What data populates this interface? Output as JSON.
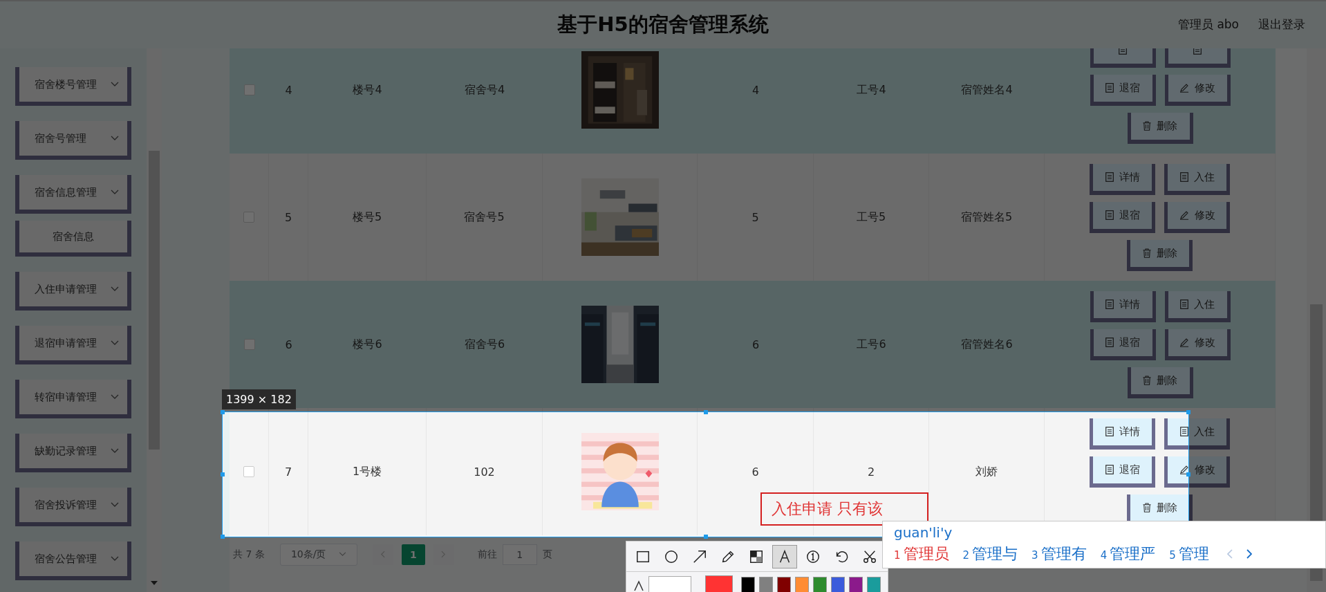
{
  "header": {
    "title": "基于H5的宿舍管理系统",
    "user": "管理员 abo",
    "logout": "退出登录"
  },
  "sidebar": {
    "items": [
      {
        "label": "宿舍楼号管理",
        "kind": "group"
      },
      {
        "label": "宿舍号管理",
        "kind": "group"
      },
      {
        "label": "宿舍信息管理",
        "kind": "group"
      },
      {
        "label": "宿舍信息",
        "kind": "item"
      },
      {
        "label": "入住申请管理",
        "kind": "group"
      },
      {
        "label": "退宿申请管理",
        "kind": "group"
      },
      {
        "label": "转宿申请管理",
        "kind": "group"
      },
      {
        "label": "缺勤记录管理",
        "kind": "group"
      },
      {
        "label": "宿舍投诉管理",
        "kind": "group"
      },
      {
        "label": "宿舍公告管理",
        "kind": "group"
      }
    ]
  },
  "table": {
    "rows": [
      {
        "checked": false,
        "id": "4",
        "building": "楼号4",
        "room": "宿舍号4",
        "count": "4",
        "staff_no": "工号4",
        "staff_name": "宿管姓名4",
        "actions": [
          {
            "kind": "doc"
          },
          {
            "kind": "doc"
          },
          {
            "label": "退宿",
            "kind": "doc"
          },
          {
            "label": "修改",
            "kind": "edit"
          },
          {
            "label": "删除",
            "kind": "delete"
          }
        ]
      },
      {
        "checked": false,
        "id": "5",
        "building": "楼号5",
        "room": "宿舍号5",
        "count": "5",
        "staff_no": "工号5",
        "staff_name": "宿管姓名5",
        "actions": [
          {
            "label": "详情",
            "kind": "doc"
          },
          {
            "label": "入住",
            "kind": "doc"
          },
          {
            "label": "退宿",
            "kind": "doc"
          },
          {
            "label": "修改",
            "kind": "edit"
          },
          {
            "label": "删除",
            "kind": "delete"
          }
        ]
      },
      {
        "checked": false,
        "id": "6",
        "building": "楼号6",
        "room": "宿舍号6",
        "count": "6",
        "staff_no": "工号6",
        "staff_name": "宿管姓名6",
        "actions": [
          {
            "label": "详情",
            "kind": "doc"
          },
          {
            "label": "入住",
            "kind": "doc"
          },
          {
            "label": "退宿",
            "kind": "doc"
          },
          {
            "label": "修改",
            "kind": "edit"
          },
          {
            "label": "删除",
            "kind": "delete"
          }
        ]
      },
      {
        "checked": false,
        "id": "7",
        "building": "1号楼",
        "room": "102",
        "count": "6",
        "staff_no": "2",
        "staff_name": "刘娇",
        "actions": [
          {
            "label": "详情",
            "kind": "doc"
          },
          {
            "label": "入住",
            "kind": "doc"
          },
          {
            "label": "退宿",
            "kind": "doc"
          },
          {
            "label": "修改",
            "kind": "edit"
          },
          {
            "label": "删除",
            "kind": "delete"
          }
        ]
      }
    ]
  },
  "pagination": {
    "total": "共 7 条",
    "page_size": "10条/页",
    "pages": [
      {
        "label": "1",
        "selected": true
      }
    ],
    "goto_label": "前往",
    "goto_value": "1",
    "goto_suffix": "页"
  },
  "screenshot_tool": {
    "size_label": "1399 × 182",
    "annotation": "入住申请 只有该",
    "tools": [
      {
        "kind": "rect",
        "selected": false
      },
      {
        "kind": "circle",
        "selected": false
      },
      {
        "kind": "arrow",
        "selected": false
      },
      {
        "kind": "pencil",
        "selected": false
      },
      {
        "kind": "mosaic",
        "selected": false
      },
      {
        "kind": "text",
        "selected": true
      },
      {
        "kind": "number",
        "selected": false
      },
      {
        "kind": "undo",
        "selected": false
      },
      {
        "kind": "cut",
        "selected": false
      }
    ],
    "colors": [
      {
        "color": "#ff3333",
        "selected": true
      },
      {
        "color": "#000000",
        "selected": false
      },
      {
        "color": "#808080",
        "selected": false
      },
      {
        "color": "#800000",
        "selected": false
      },
      {
        "color": "#ff8c33",
        "selected": false
      },
      {
        "color": "#2e8b2e",
        "selected": false
      },
      {
        "color": "#3b5bdb",
        "selected": false
      },
      {
        "color": "#8b1a8b",
        "selected": false
      },
      {
        "color": "#1a9c9c",
        "selected": false
      }
    ]
  },
  "ime": {
    "composition": "guan'li'y",
    "candidates": [
      {
        "index": "1",
        "text": "管理员",
        "selected": true
      },
      {
        "index": "2",
        "text": "管理与",
        "selected": false
      },
      {
        "index": "3",
        "text": "管理有",
        "selected": false
      },
      {
        "index": "4",
        "text": "管理严",
        "selected": false
      },
      {
        "index": "5",
        "text": "管理",
        "selected": false
      }
    ]
  }
}
